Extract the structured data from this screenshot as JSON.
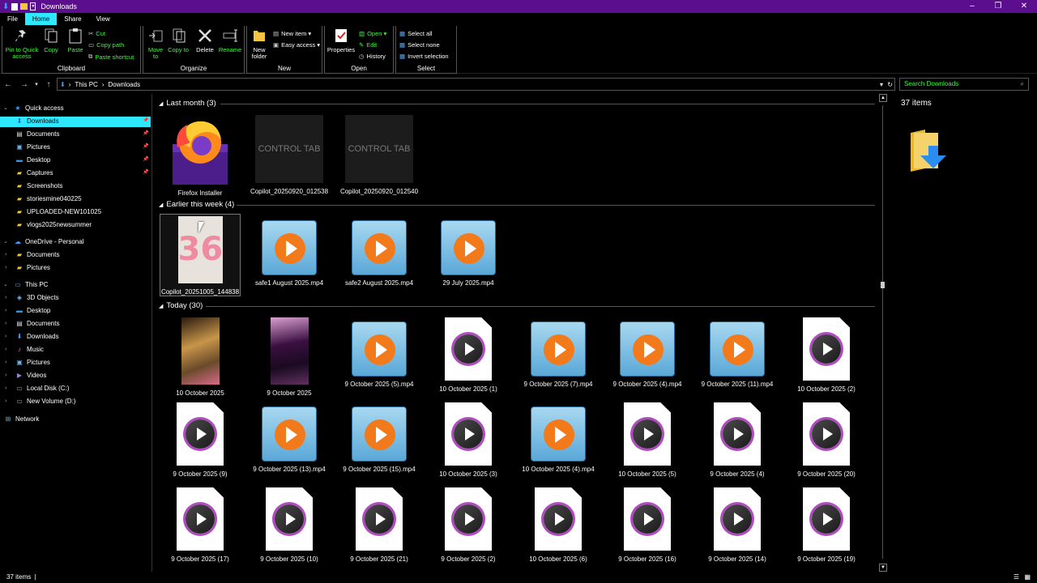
{
  "window": {
    "title": "Downloads",
    "controls": [
      "–",
      "❐",
      "✕"
    ]
  },
  "tabs": [
    {
      "label": "File",
      "active": false
    },
    {
      "label": "Home",
      "active": true
    },
    {
      "label": "Share",
      "active": false
    },
    {
      "label": "View",
      "active": false
    }
  ],
  "ribbon": {
    "clipboard": {
      "title": "Clipboard",
      "pin": "Pin to Quick access",
      "copy": "Copy",
      "paste": "Paste",
      "cut": "Cut",
      "copy_path": "Copy path",
      "paste_shortcut": "Paste shortcut"
    },
    "organize": {
      "title": "Organize",
      "move_to": "Move to",
      "copy_to": "Copy to",
      "delete": "Delete",
      "rename": "Rename"
    },
    "new": {
      "title": "New",
      "new_folder": "New folder",
      "new_item": "New item ▾",
      "easy_access": "Easy access ▾"
    },
    "open": {
      "title": "Open",
      "properties": "Properties",
      "open": "Open ▾",
      "edit": "Edit",
      "history": "History"
    },
    "select": {
      "title": "Select",
      "select_all": "Select all",
      "select_none": "Select none",
      "invert": "Invert selection"
    }
  },
  "address": {
    "crumbs": [
      "This PC",
      "Downloads"
    ],
    "search_placeholder": "Search Downloads"
  },
  "nav": {
    "quick_access": "Quick access",
    "quick_items": [
      "Downloads",
      "Documents",
      "Pictures",
      "Desktop",
      "Captures",
      "Screenshots",
      "storiesmine040225",
      "UPLOADED-NEW101025",
      "vlogs2025newsummer"
    ],
    "onedrive": "OneDrive - Personal",
    "onedrive_items": [
      "Documents",
      "Pictures"
    ],
    "this_pc": "This PC",
    "pc_items": [
      "3D Objects",
      "Desktop",
      "Documents",
      "Downloads",
      "Music",
      "Pictures",
      "Videos",
      "Local Disk (C:)",
      "New Volume (D:)"
    ],
    "network": "Network"
  },
  "groups": [
    {
      "header": "Last month (3)",
      "items": [
        {
          "name": "Firefox Installer",
          "icon": "firefox"
        },
        {
          "name": "Copilot_20250920_012538",
          "icon": "control-tab",
          "thumb_text": "CONTROL TAB"
        },
        {
          "name": "Copilot_20250920_012540",
          "icon": "control-tab",
          "thumb_text": "CONTROL TAB"
        }
      ]
    },
    {
      "header": "Earlier this week (4)",
      "items": [
        {
          "name": "Copilot_20251005_144838",
          "icon": "photo-36",
          "thumb_text": "36"
        },
        {
          "name": "safe1 August 2025.mp4",
          "icon": "wmp"
        },
        {
          "name": "safe2 August 2025.mp4",
          "icon": "wmp"
        },
        {
          "name": "29 July 2025.mp4",
          "icon": "wmp"
        }
      ]
    },
    {
      "header": "Today (30)",
      "items": [
        {
          "name": "10 October 2025",
          "icon": "photo-a"
        },
        {
          "name": "9 October 2025",
          "icon": "photo-b"
        },
        {
          "name": "9 October 2025 (5).mp4",
          "icon": "wmp"
        },
        {
          "name": "10 October 2025 (1)",
          "icon": "video"
        },
        {
          "name": "9 October 2025 (7).mp4",
          "icon": "wmp"
        },
        {
          "name": "9 October 2025 (4).mp4",
          "icon": "wmp"
        },
        {
          "name": "9 October 2025 (11).mp4",
          "icon": "wmp"
        },
        {
          "name": "10 October 2025 (2)",
          "icon": "video"
        },
        {
          "name": "9 October 2025 (9)",
          "icon": "video"
        },
        {
          "name": "9 October 2025 (13).mp4",
          "icon": "wmp"
        },
        {
          "name": "9 October 2025 (15).mp4",
          "icon": "wmp"
        },
        {
          "name": "10 October 2025 (3)",
          "icon": "video"
        },
        {
          "name": "10 October 2025 (4).mp4",
          "icon": "wmp"
        },
        {
          "name": "10 October 2025 (5)",
          "icon": "video"
        },
        {
          "name": "9 October 2025 (4)",
          "icon": "video"
        },
        {
          "name": "9 October 2025 (20)",
          "icon": "video"
        },
        {
          "name": "9 October 2025 (17)",
          "icon": "video"
        },
        {
          "name": "9 October 2025 (10)",
          "icon": "video"
        },
        {
          "name": "9 October 2025 (21)",
          "icon": "video"
        },
        {
          "name": "9 October 2025 (2)",
          "icon": "video"
        },
        {
          "name": "10 October 2025 (6)",
          "icon": "video"
        },
        {
          "name": "9 October 2025 (16)",
          "icon": "video"
        },
        {
          "name": "9 October 2025 (14)",
          "icon": "video"
        },
        {
          "name": "9 October 2025 (19)",
          "icon": "video"
        }
      ]
    }
  ],
  "preview": {
    "count": "37 items"
  },
  "status": {
    "count": "37 items",
    "divider": "|"
  },
  "colors": {
    "titlebar": "#5b0f8f",
    "accent": "#2ee8ff",
    "ribbon_text_green": "#38ff38"
  }
}
